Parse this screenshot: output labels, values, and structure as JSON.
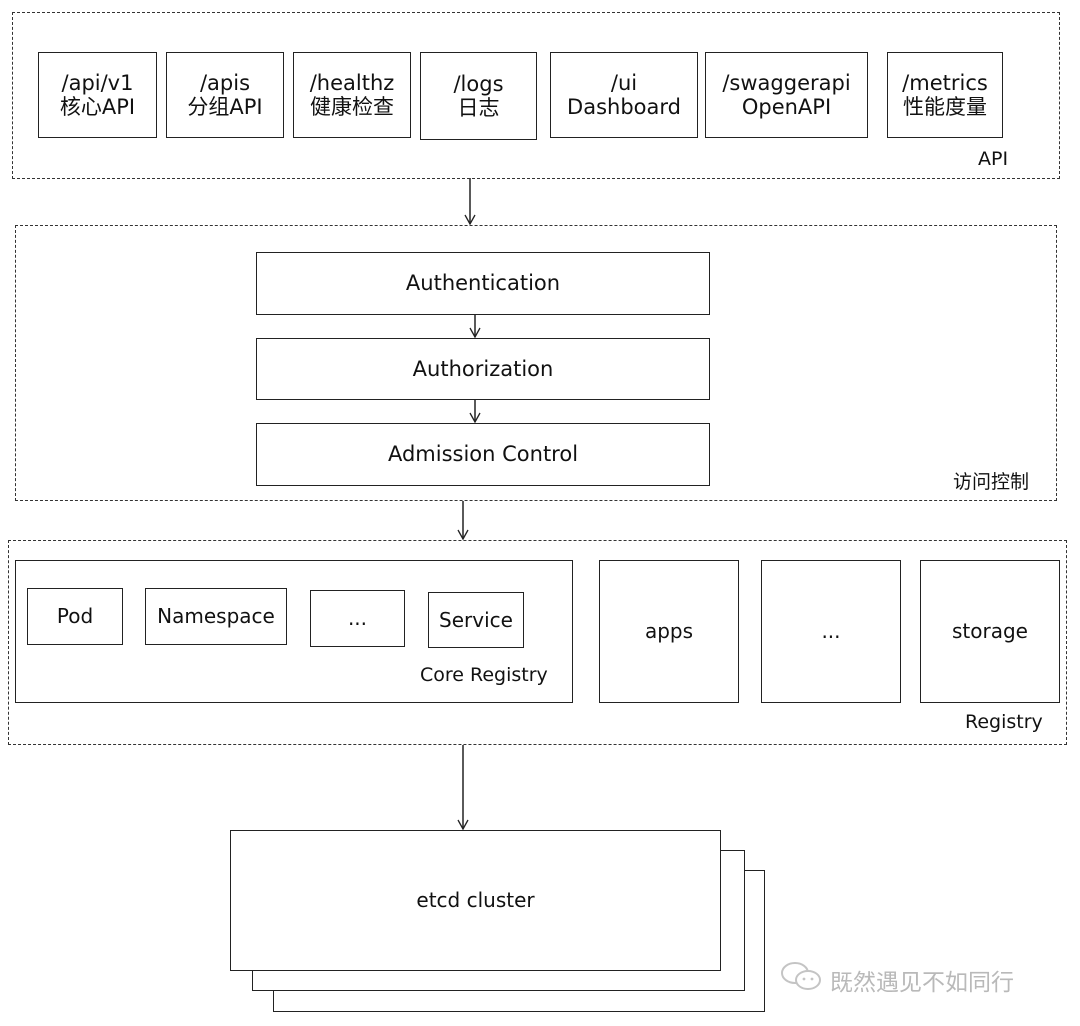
{
  "api_layer": {
    "label": "API",
    "endpoints": [
      {
        "path": "/api/v1",
        "desc": "核心API"
      },
      {
        "path": "/apis",
        "desc": "分组API"
      },
      {
        "path": "/healthz",
        "desc": "健康检查"
      },
      {
        "path": "/logs",
        "desc": "日志"
      },
      {
        "path": "/ui",
        "desc": "Dashboard"
      },
      {
        "path": "/swaggerapi",
        "desc": "OpenAPI"
      },
      {
        "path": "/metrics",
        "desc": "性能度量"
      }
    ]
  },
  "access_control": {
    "label": "访问控制",
    "steps": [
      "Authentication",
      "Authorization",
      "Admission Control"
    ]
  },
  "registry": {
    "label": "Registry",
    "core": {
      "label": "Core Registry",
      "items": [
        "Pod",
        "Namespace",
        "...",
        "Service"
      ]
    },
    "groups": [
      "apps",
      "...",
      "storage"
    ]
  },
  "storage": {
    "label": "etcd cluster"
  },
  "watermark": {
    "icon": "wechat-icon",
    "text": "既然遇见不如同行"
  }
}
